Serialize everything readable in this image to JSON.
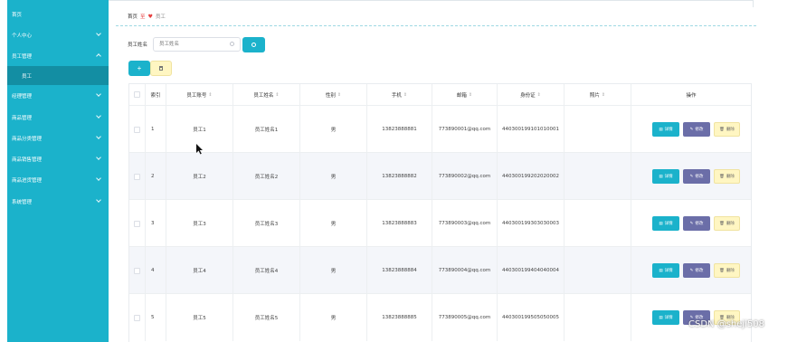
{
  "sidebar": {
    "home": "首页",
    "items": [
      {
        "label": "个人中心"
      },
      {
        "label": "员工管理"
      },
      {
        "label": "经理管理"
      },
      {
        "label": "商品管理"
      },
      {
        "label": "商品分类管理"
      },
      {
        "label": "商品销售管理"
      },
      {
        "label": "商品进货管理"
      },
      {
        "label": "系统管理"
      }
    ],
    "active_sub": "员工"
  },
  "breadcrumb": {
    "home": "首页",
    "sep": "至",
    "current": "员工"
  },
  "search": {
    "label": "员工姓名",
    "placeholder": "员工姓名"
  },
  "actions": {
    "add": "+",
    "delete_icon": "trash-icon"
  },
  "table": {
    "headers": [
      "索引",
      "员工账号",
      "员工姓名",
      "性别",
      "手机",
      "邮箱",
      "身份证",
      "照片",
      "操作"
    ],
    "rows": [
      {
        "index": "1",
        "account": "员工1",
        "name": "员工姓名1",
        "gender": "男",
        "phone": "13823888881",
        "email": "773890001@qq.com",
        "id_card": "440300199101010001"
      },
      {
        "index": "2",
        "account": "员工2",
        "name": "员工姓名2",
        "gender": "男",
        "phone": "13823888882",
        "email": "773890002@qq.com",
        "id_card": "440300199202020002"
      },
      {
        "index": "3",
        "account": "员工3",
        "name": "员工姓名3",
        "gender": "男",
        "phone": "13823888883",
        "email": "773890003@qq.com",
        "id_card": "440300199303030003"
      },
      {
        "index": "4",
        "account": "员工4",
        "name": "员工姓名4",
        "gender": "男",
        "phone": "13823888884",
        "email": "773890004@qq.com",
        "id_card": "440300199404040004"
      },
      {
        "index": "5",
        "account": "员工5",
        "name": "员工姓名5",
        "gender": "男",
        "phone": "13823888885",
        "email": "773890005@qq.com",
        "id_card": "440300199505050005"
      }
    ],
    "op_labels": {
      "detail": "详情",
      "edit": "修改",
      "delete": "删除"
    }
  },
  "watermark": "CSDN @sheji508",
  "colors": {
    "primary": "#1bb2cb",
    "edit": "#6b6ea8",
    "delete": "#fff6c2"
  }
}
